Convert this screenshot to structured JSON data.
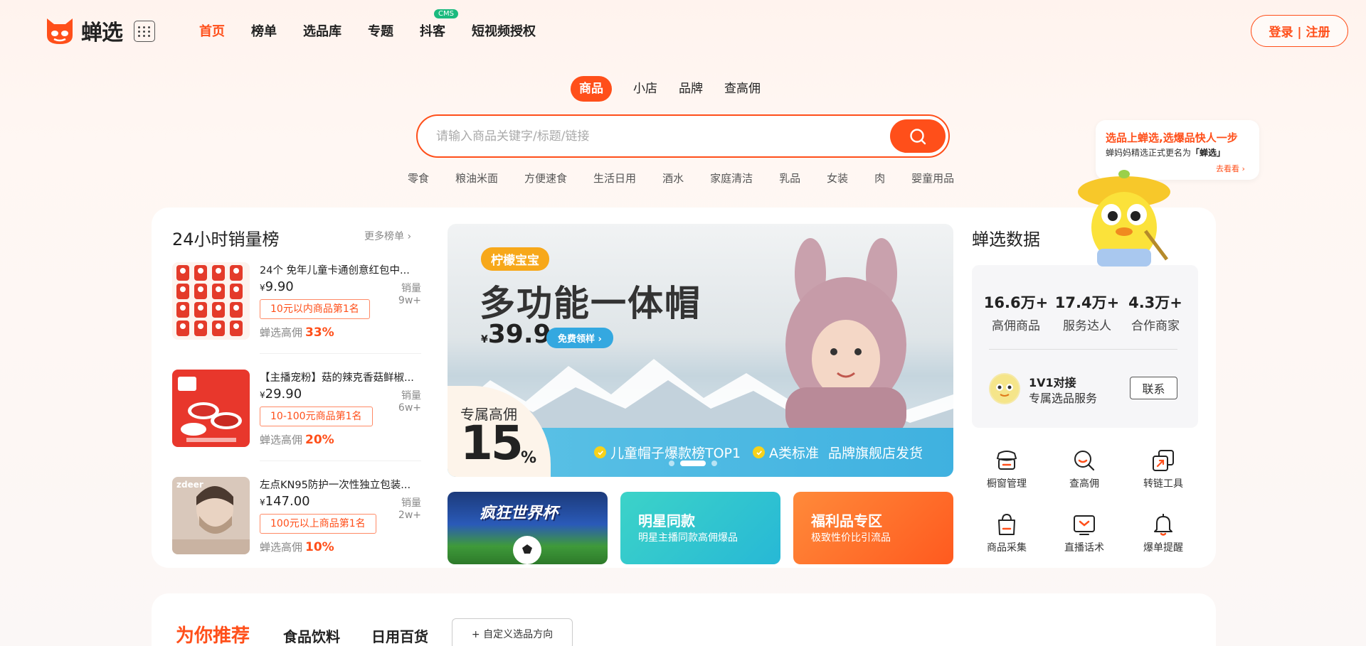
{
  "brand": {
    "name": "蝉选",
    "accent": "#ff4f1a"
  },
  "nav": {
    "items": [
      {
        "label": "首页",
        "active": true
      },
      {
        "label": "榜单"
      },
      {
        "label": "选品库"
      },
      {
        "label": "专题"
      },
      {
        "label": "抖客",
        "badge": "CMS"
      },
      {
        "label": "短视频授权"
      }
    ],
    "login": "登录 | 注册"
  },
  "search": {
    "tabs": [
      "商品",
      "小店",
      "品牌",
      "查高佣"
    ],
    "placeholder": "请输入商品关键字/标题/链接",
    "hot_words": [
      "零食",
      "粮油米面",
      "方便速食",
      "生活日用",
      "酒水",
      "家庭清洁",
      "乳品",
      "女装",
      "肉",
      "婴童用品"
    ]
  },
  "ranking": {
    "title": "24小时销量榜",
    "more": "更多榜单",
    "comm_label": "蝉选高佣",
    "items": [
      {
        "name": "24个 免年儿童卡通创意红包中...",
        "currency": "¥",
        "price": "9.90",
        "sales": "销量 9w+",
        "tag": "10元以内商品第1名",
        "commission": "33%"
      },
      {
        "name": "【主播宠粉】菇的辣克香菇鲜椒...",
        "currency": "¥",
        "price": "29.90",
        "sales": "销量 6w+",
        "tag": "10-100元商品第1名",
        "commission": "20%"
      },
      {
        "name": "左点KN95防护一次性独立包装...",
        "currency": "¥",
        "price": "147.00",
        "sales": "销量 2w+",
        "tag": "100元以上商品第1名",
        "commission": "10%"
      }
    ]
  },
  "banner": {
    "brand": "柠檬宝宝",
    "title": "多功能一体帽",
    "currency": "¥",
    "price": "39.9",
    "cta": "免费领样",
    "comm_label": "专属高佣",
    "comm_value": "15",
    "comm_unit": "%",
    "features": [
      "儿童帽子爆款榜TOP1",
      "A类标准",
      "品牌旗舰店发货"
    ]
  },
  "sub_banners": [
    {
      "title": "疯狂世界杯",
      "desc": ""
    },
    {
      "title": "明星同款",
      "desc": "明星主播同款高佣爆品"
    },
    {
      "title": "福利品专区",
      "desc": "极致性价比引流品"
    }
  ],
  "data_panel": {
    "title": "蝉选数据",
    "stats": [
      {
        "value": "16.6万+",
        "label": "高佣商品"
      },
      {
        "value": "17.4万+",
        "label": "服务达人"
      },
      {
        "value": "4.3万+",
        "label": "合作商家"
      }
    ],
    "contact_title": "1V1对接",
    "contact_sub": "专属选品服务",
    "contact_btn": "联系",
    "tools": [
      "橱窗管理",
      "查高佣",
      "转链工具",
      "商品采集",
      "直播话术",
      "爆单提醒"
    ]
  },
  "promo": {
    "title": "选品上蝉选,选爆品快人一步",
    "sub_prefix": "蝉妈妈精选正式更名为",
    "sub_name": "「蝉选」",
    "link": "去看看"
  },
  "recommend": {
    "title": "为你推荐",
    "tabs": [
      "食品饮料",
      "日用百货"
    ],
    "custom": "+ 自定义选品方向"
  }
}
